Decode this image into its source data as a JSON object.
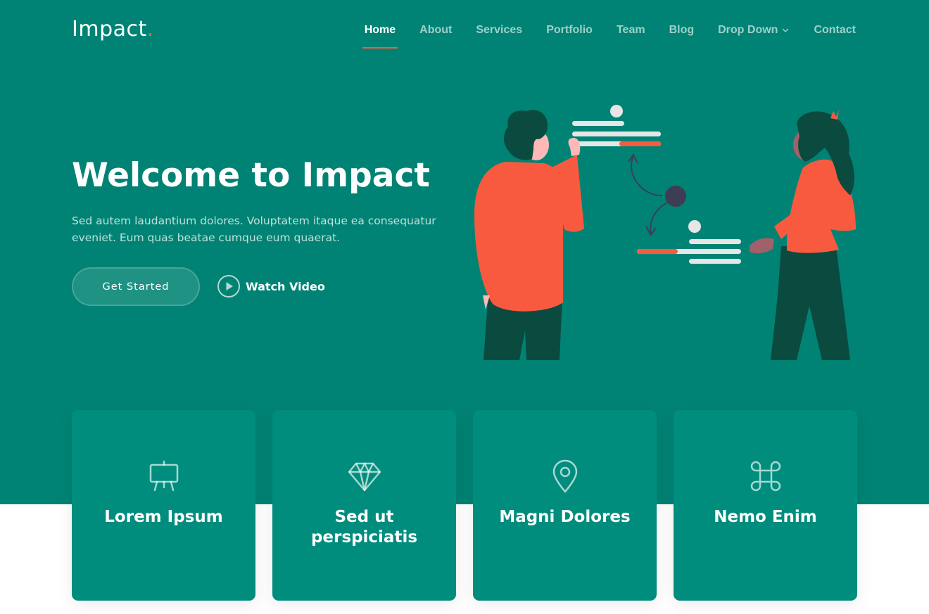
{
  "brand": {
    "name": "Impact",
    "dot": "."
  },
  "nav": {
    "items": [
      {
        "label": "Home",
        "active": true
      },
      {
        "label": "About"
      },
      {
        "label": "Services"
      },
      {
        "label": "Portfolio"
      },
      {
        "label": "Team"
      },
      {
        "label": "Blog"
      },
      {
        "label": "Drop Down",
        "icon": "chevron-down-icon"
      },
      {
        "label": "Contact"
      }
    ]
  },
  "hero": {
    "title": "Welcome to Impact",
    "subtitle": "Sed autem laudantium dolores. Voluptatem itaque ea consequatur eveniet. Eum quas beatae cumque eum quaerat.",
    "cta_label": "Get Started",
    "video_label": "Watch Video",
    "video_icon": "play-circle-icon"
  },
  "cards": [
    {
      "title": "Lorem Ipsum",
      "icon": "easel-icon"
    },
    {
      "title": "Sed ut perspiciatis",
      "icon": "gem-icon"
    },
    {
      "title": "Magni Dolores",
      "icon": "geo-pin-icon"
    },
    {
      "title": "Nemo Enim",
      "icon": "command-icon"
    }
  ],
  "colors": {
    "primary": "#008374",
    "card": "#008d7d",
    "accent": "#f85a40",
    "white": "#ffffff"
  }
}
